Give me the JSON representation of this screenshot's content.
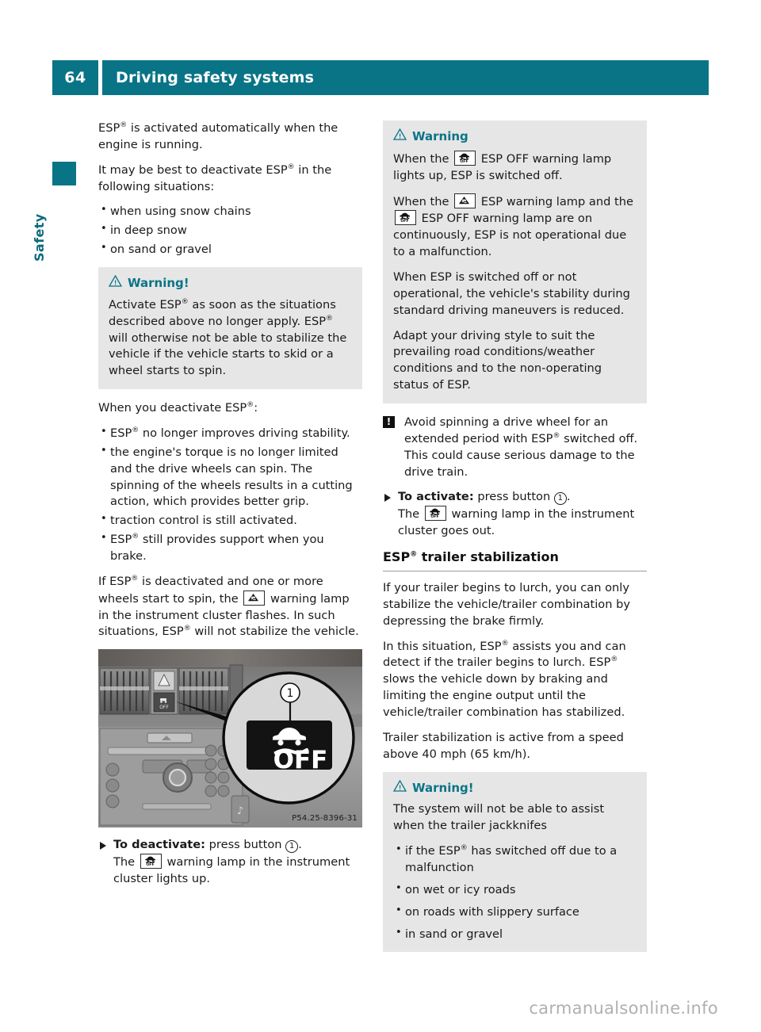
{
  "header": {
    "page_number": "64",
    "title": "Driving safety systems",
    "accent_color": "#0a7487"
  },
  "side_tab": {
    "label": "Safety"
  },
  "left_column": {
    "para_1": "ESP® is activated automatically when the engine is running.",
    "para_2": "It may be best to deactivate ESP® in the following situations:",
    "bullets_1": [
      "when using snow chains",
      "in deep snow",
      "on sand or gravel"
    ],
    "warning_1": {
      "icon": "warning-triangle-icon",
      "title": "Warning!",
      "body": "Activate ESP® as soon as the situations described above no longer apply. ESP® will otherwise not be able to stabilize the vehicle if the vehicle starts to skid or a wheel starts to spin."
    },
    "para_3": "When you deactivate ESP®:",
    "bullets_2": [
      "ESP® no longer improves driving stability.",
      "the engine's torque is no longer limited and the drive wheels can spin. The spinning of the wheels results in a cutting action, which provides better grip.",
      "traction control is still activated.",
      "ESP® still provides support when you brake."
    ],
    "para_4_part_1": "If ESP® is deactivated and one or more wheels start to spin, the",
    "para_4_lamp": "esp-warning-lamp-icon",
    "para_4_part_2": "warning lamp in the instrument cluster flashes. In such situations, ESP® will not stabilize the vehicle.",
    "figure": {
      "alt": "dashboard-esp-off-button-photo",
      "callout_number": "1",
      "button_label": "OFF",
      "caption": "P54.25-8396-31"
    },
    "step_1": {
      "marker": "arrow-marker",
      "bold_lead": "To deactivate:",
      "rest": "press button",
      "ref_number": "1",
      "suffix": ".",
      "follow_part_1": "The",
      "follow_lamp": "esp-off-warning-lamp-icon",
      "follow_part_2": "warning lamp in the instrument cluster lights up."
    }
  },
  "right_column": {
    "warning_1": {
      "icon": "warning-triangle-icon",
      "title": "Warning",
      "line_1_part_1": "When the",
      "line_1_lamp": "esp-off-warning-lamp-icon",
      "line_1_part_2": "ESP OFF warning lamp lights up, ESP is switched off.",
      "line_2_part_1": "When the",
      "line_2_lamp_a": "esp-warning-lamp-icon",
      "line_2_part_2": "ESP warning lamp and the",
      "line_2_lamp_b": "esp-off-warning-lamp-icon",
      "line_2_part_3": "ESP OFF warning lamp are on continuously, ESP is not operational due to a malfunction.",
      "line_3": "When ESP is switched off or not operational, the vehicle's stability during standard driving maneuvers is reduced.",
      "line_4": "Adapt your driving style to suit the prevailing road conditions/weather conditions and to the non-operating status of ESP."
    },
    "note_1": {
      "marker": "!",
      "body": "Avoid spinning a drive wheel for an extended period with ESP® switched off. This could cause serious damage to the drive train."
    },
    "step_1": {
      "marker": "arrow-marker",
      "bold_lead": "To activate:",
      "rest": "press button",
      "ref_number": "1",
      "suffix": ".",
      "follow_part_1": "The",
      "follow_lamp": "esp-off-warning-lamp-icon",
      "follow_part_2": "warning lamp in the instrument cluster goes out."
    },
    "section_heading": "ESP® trailer stabilization",
    "para_1": "If your trailer begins to lurch, you can only stabilize the vehicle/trailer combination by depressing the brake firmly.",
    "para_2": "In this situation, ESP® assists you and can detect if the trailer begins to lurch. ESP® slows the vehicle down by braking and limiting the engine output until the vehicle/trailer combination has stabilized.",
    "para_3": "Trailer stabilization is active from a speed above 40 mph (65 km/h).",
    "warning_2": {
      "icon": "warning-triangle-icon",
      "title": "Warning!",
      "body": "The system will not be able to assist when the trailer jackknifes",
      "bullets": [
        "if the ESP® has switched off due to a malfunction",
        "on wet or icy roads",
        "on roads with slippery surface",
        "in sand or gravel"
      ]
    }
  },
  "watermark": "carmanualsonline.info"
}
